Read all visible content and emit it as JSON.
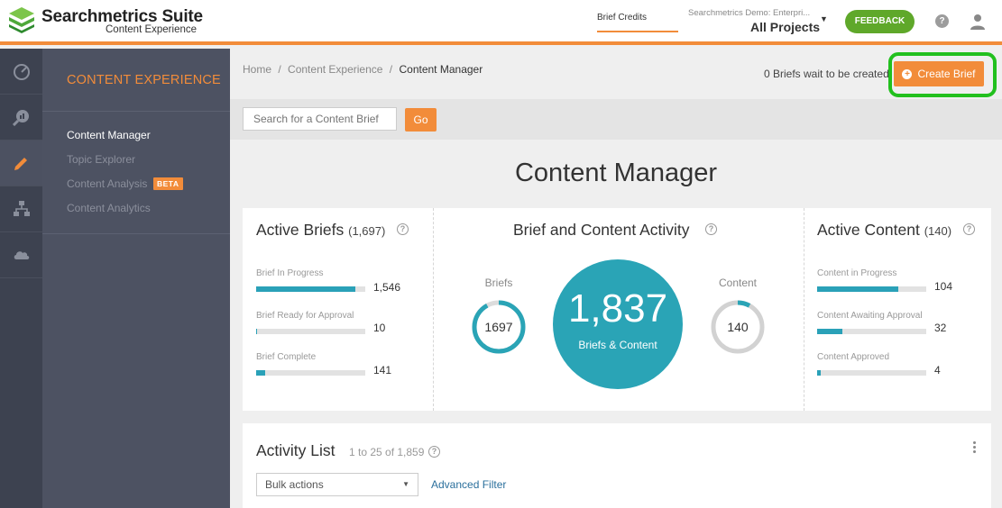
{
  "header": {
    "brand": "Searchmetrics Suite",
    "brand_sub": "Content Experience",
    "brief_credits": "Brief Credits",
    "project_account": "Searchmetrics Demo: Enterpri...",
    "project_name": "All Projects",
    "feedback": "FEEDBACK",
    "help": "?"
  },
  "rail": {
    "icons": [
      "speedometer-icon",
      "search-analytics-icon",
      "pencil-icon",
      "sitemap-icon",
      "cloud-icon"
    ],
    "active_index": 2
  },
  "sidebar": {
    "title": "CONTENT EXPERIENCE",
    "items": [
      {
        "label": "Content Manager"
      },
      {
        "label": "Topic Explorer"
      },
      {
        "label": "Content Analysis"
      },
      {
        "label": "Content Analytics"
      }
    ],
    "beta": "BETA"
  },
  "main": {
    "breadcrumb": {
      "home": "Home",
      "sep": "/",
      "section": "Content Experience",
      "current": "Content Manager"
    },
    "wait_message": "0 Briefs wait to be created",
    "create_button": "Create Brief",
    "search": {
      "placeholder": "Search for a Content Brief",
      "go": "Go"
    },
    "page_title": "Content Manager",
    "active_briefs": {
      "title": "Active Briefs",
      "count": "(1,697)",
      "items": [
        {
          "label": "Brief In Progress",
          "value": "1,546",
          "fill": 0.91
        },
        {
          "label": "Brief Ready for Approval",
          "value": "10",
          "fill": 0.01
        },
        {
          "label": "Brief Complete",
          "value": "141",
          "fill": 0.08
        }
      ]
    },
    "activity": {
      "title": "Brief and Content Activity",
      "briefs_label": "Briefs",
      "briefs_value": "1697",
      "briefs_fill": 0.92,
      "content_label": "Content",
      "content_value": "140",
      "content_fill": 0.08,
      "total": "1,837",
      "total_label": "Briefs & Content"
    },
    "active_content": {
      "title": "Active Content",
      "count": "(140)",
      "items": [
        {
          "label": "Content in Progress",
          "value": "104",
          "fill": 0.74
        },
        {
          "label": "Content Awaiting Approval",
          "value": "32",
          "fill": 0.23
        },
        {
          "label": "Content Approved",
          "value": "4",
          "fill": 0.03
        }
      ]
    },
    "activity_list": {
      "title": "Activity List",
      "range": "1 to 25 of 1,859",
      "bulk_actions": "Bulk actions",
      "advanced_filter": "Advanced Filter"
    }
  },
  "colors": {
    "accent": "#f28c3a",
    "teal": "#2aa4b6",
    "feedback": "#5fa82a",
    "highlight": "#22c01e"
  }
}
